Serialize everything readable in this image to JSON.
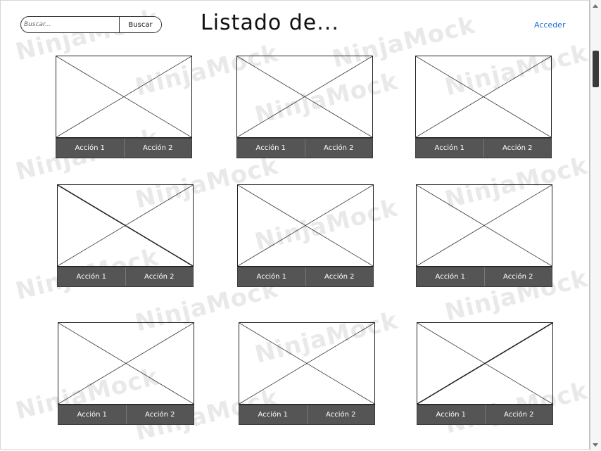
{
  "header": {
    "search_placeholder": "Buscar...",
    "search_button": "Buscar",
    "title": "Listado de...",
    "login_link": "Acceder"
  },
  "watermark_text": "NinjaMock",
  "cards": [
    {
      "action1": "Acción 1",
      "action2": "Acción 2"
    },
    {
      "action1": "Acción 1",
      "action2": "Acción 2"
    },
    {
      "action1": "Acción 1",
      "action2": "Acción 2"
    },
    {
      "action1": "Acción 1",
      "action2": "Acción 2"
    },
    {
      "action1": "Acción 1",
      "action2": "Acción 2"
    },
    {
      "action1": "Acción 1",
      "action2": "Acción 2"
    },
    {
      "action1": "Acción 1",
      "action2": "Acción 2"
    },
    {
      "action1": "Acción 1",
      "action2": "Acción 2"
    },
    {
      "action1": "Acción 1",
      "action2": "Acción 2"
    }
  ],
  "colors": {
    "link": "#1a6fd6",
    "action_bar": "#555555",
    "border": "#222222"
  }
}
